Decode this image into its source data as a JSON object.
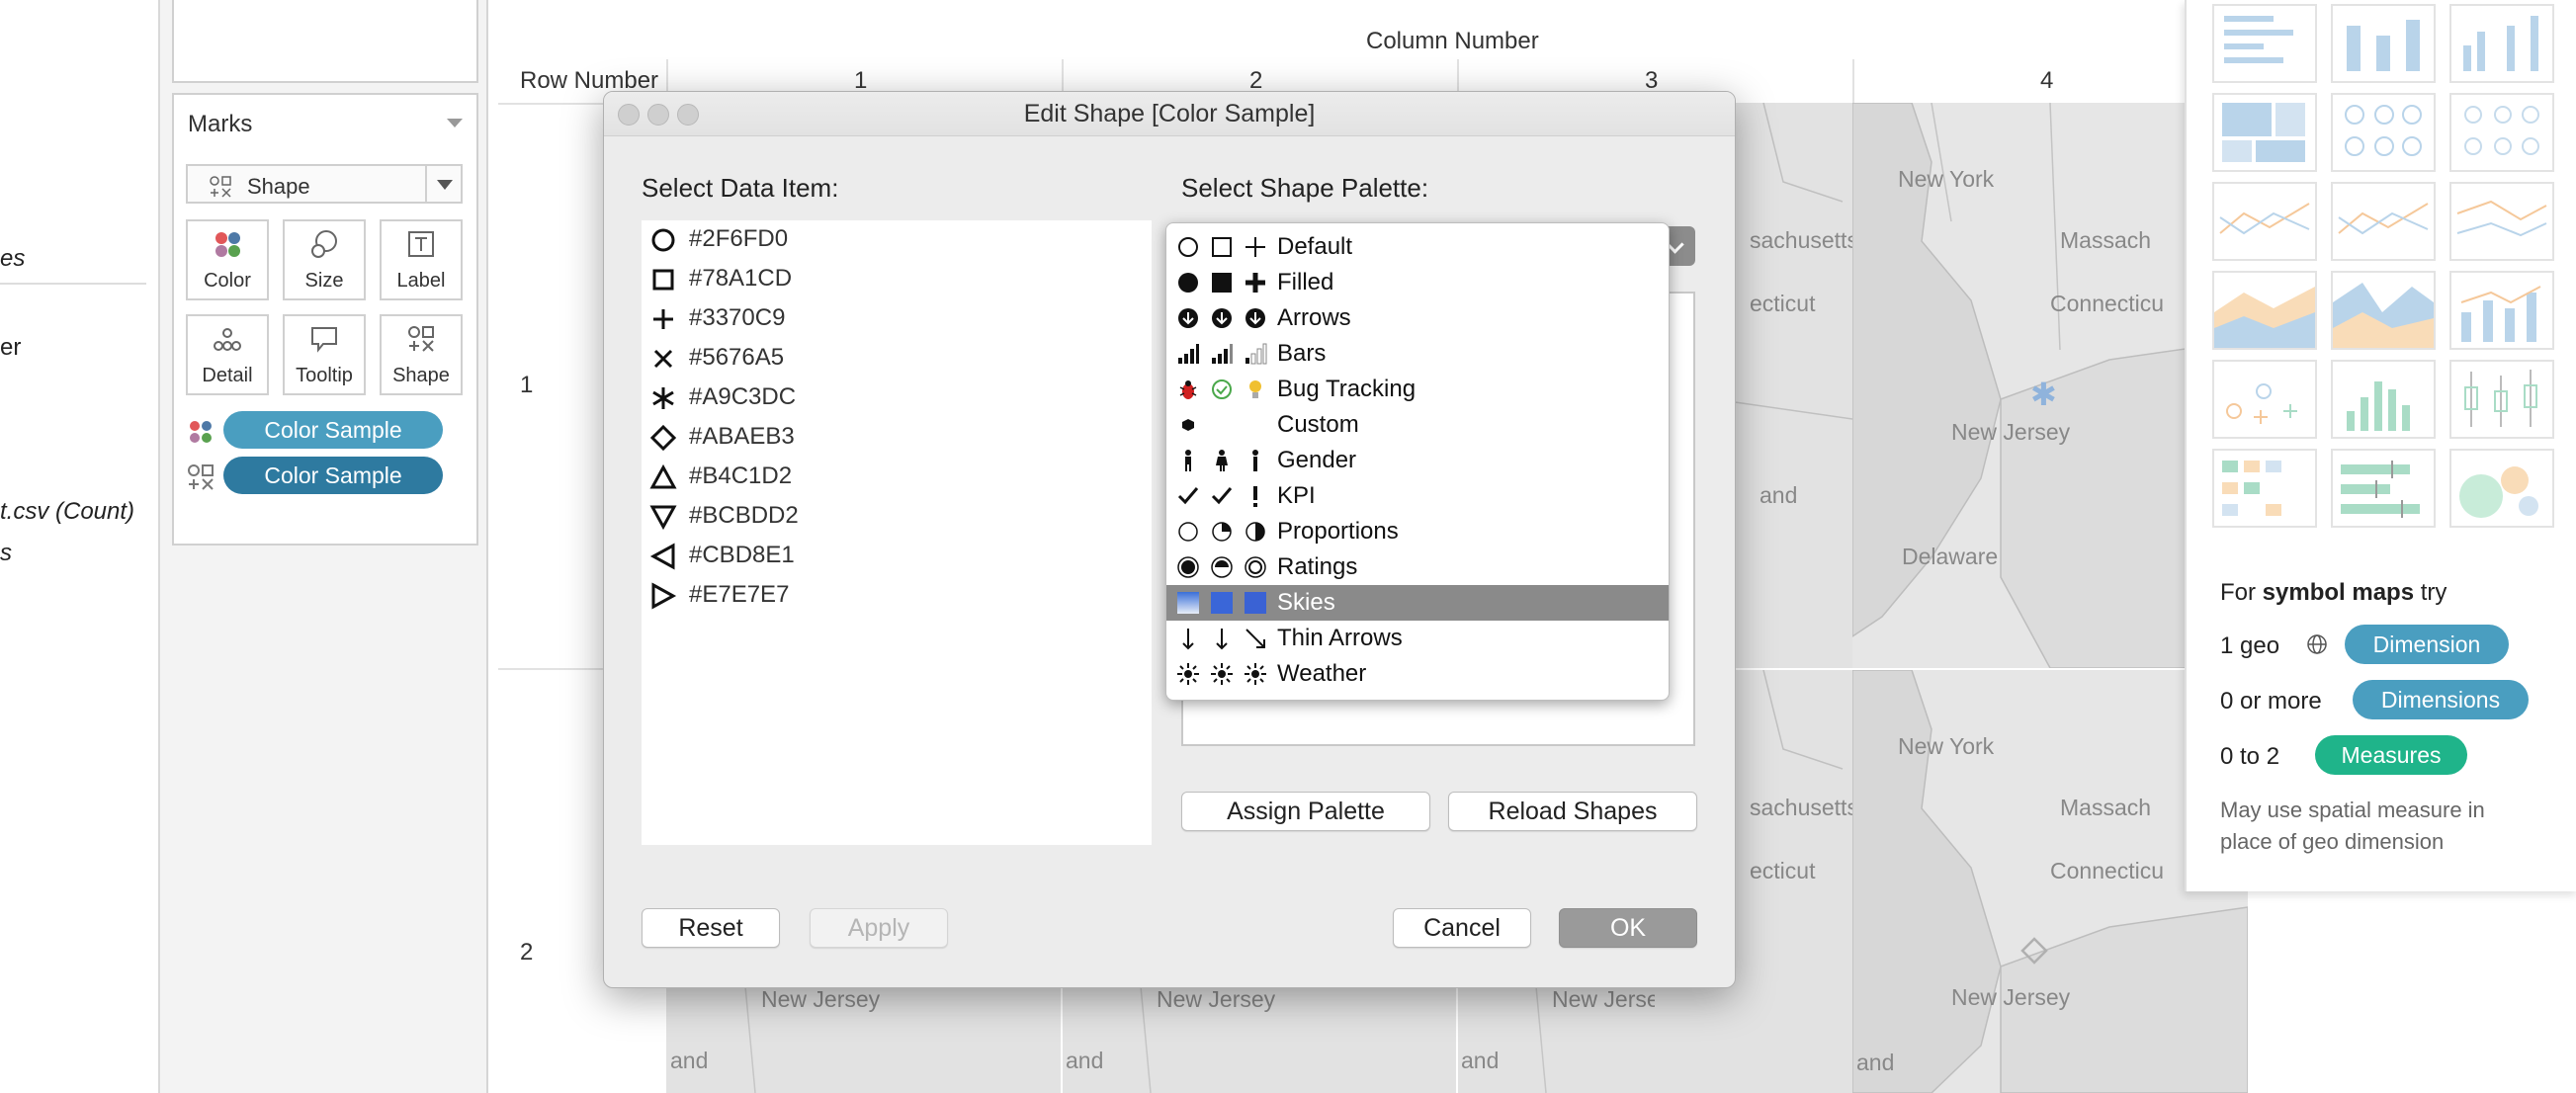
{
  "left_panel": {
    "items": [
      "es",
      "er",
      "t.csv (Count)",
      "s"
    ]
  },
  "marks": {
    "title": "Marks",
    "mark_type": "Shape",
    "buttons": [
      "Color",
      "Size",
      "Label",
      "Detail",
      "Tooltip",
      "Shape"
    ],
    "pills": [
      {
        "label": "Color Sample",
        "encoding": "color-icon"
      },
      {
        "label": "Color Sample",
        "encoding": "shape-icon"
      }
    ],
    "pill_colors": [
      "#4a9ec0",
      "#2e7aa0"
    ]
  },
  "viz": {
    "column_title": "Column Number",
    "row_title": "Row Number",
    "columns": [
      "1",
      "2",
      "3",
      "4"
    ],
    "rows": [
      "1",
      "2"
    ],
    "map_labels": {
      "new_york": "New York",
      "massachusetts": "Massach",
      "sachusetts": "sachusetts",
      "connecticut": "Connecticu",
      "ecticut": "ecticut",
      "new_jersey": "New Jersey",
      "and": "and",
      "delaware": "Delaware"
    }
  },
  "show_me": {
    "hint_prefix": "For",
    "hint_bold": "symbol maps",
    "hint_suffix": "try",
    "req1_text": "1 geo",
    "req1_pill": "Dimension",
    "req2_text": "0 or more",
    "req2_pill": "Dimensions",
    "req3_text": "0 to 2",
    "req3_pill": "Measures",
    "note": "May use spatial measure in place of geo dimension",
    "colors": {
      "dimension": "#4a9ec0",
      "measure": "#1fb48a"
    }
  },
  "dialog": {
    "title": "Edit Shape [Color Sample]",
    "select_data_label": "Select Data Item:",
    "select_palette_label": "Select Shape Palette:",
    "data_items": [
      {
        "shape": "circle-open-icon",
        "label": "#2F6FD0"
      },
      {
        "shape": "square-open-icon",
        "label": "#78A1CD"
      },
      {
        "shape": "plus-icon",
        "label": "#3370C9"
      },
      {
        "shape": "x-icon",
        "label": "#5676A5"
      },
      {
        "shape": "asterisk-icon",
        "label": "#A9C3DC"
      },
      {
        "shape": "diamond-open-icon",
        "label": "#ABAEB3"
      },
      {
        "shape": "triangle-up-open-icon",
        "label": "#B4C1D2"
      },
      {
        "shape": "triangle-down-open-icon",
        "label": "#BCBDD2"
      },
      {
        "shape": "triangle-left-open-icon",
        "label": "#CBD8E1"
      },
      {
        "shape": "triangle-right-open-icon",
        "label": "#E7E7E7"
      }
    ],
    "palettes": [
      "Default",
      "Filled",
      "Arrows",
      "Bars",
      "Bug Tracking",
      "Custom",
      "Gender",
      "KPI",
      "Proportions",
      "Ratings",
      "Skies",
      "Thin Arrows",
      "Weather"
    ],
    "selected_palette": "Skies",
    "assign_button": "Assign Palette",
    "reload_button": "Reload Shapes",
    "reset_button": "Reset",
    "apply_button": "Apply",
    "cancel_button": "Cancel",
    "ok_button": "OK"
  }
}
